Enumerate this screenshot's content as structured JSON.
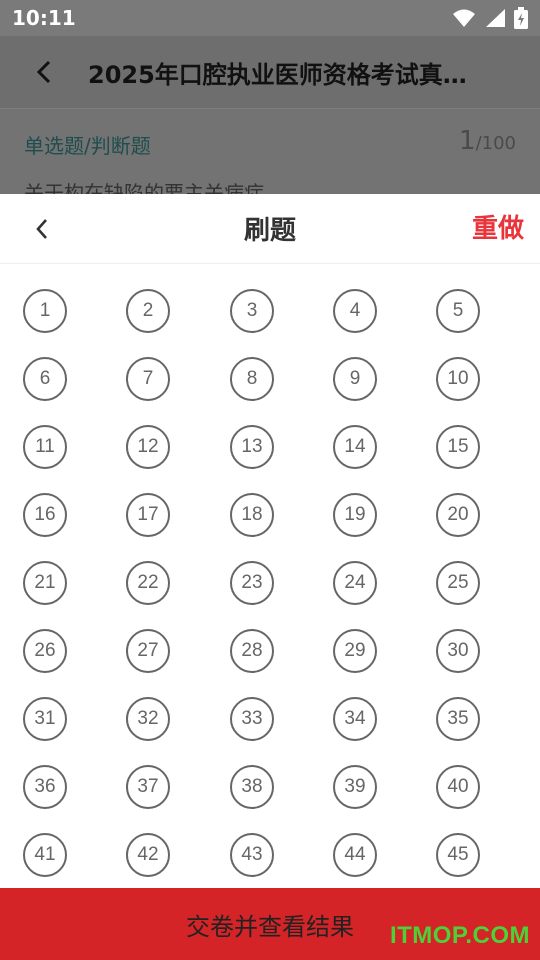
{
  "status_bar": {
    "time": "10:11"
  },
  "background_page": {
    "title": "2025年口腔执业医师资格考试真…",
    "question_type": "单选题/判断题",
    "current": "1",
    "total": "/100",
    "snippet": "关于构在缺陷的要主关病症"
  },
  "sheet": {
    "title": "刷题",
    "redo_label": "重做",
    "questions": [
      "1",
      "2",
      "3",
      "4",
      "5",
      "6",
      "7",
      "8",
      "9",
      "10",
      "11",
      "12",
      "13",
      "14",
      "15",
      "16",
      "17",
      "18",
      "19",
      "20",
      "21",
      "22",
      "23",
      "24",
      "25",
      "26",
      "27",
      "28",
      "29",
      "30",
      "31",
      "32",
      "33",
      "34",
      "35",
      "36",
      "37",
      "38",
      "39",
      "40",
      "41",
      "42",
      "43",
      "44",
      "45"
    ],
    "submit_label": "交卷并查看结果"
  },
  "watermark": "ITMOP.COM",
  "colors": {
    "accent_red": "#e8343a",
    "submit_bg": "#d42427",
    "watermark": "#4cd137"
  }
}
